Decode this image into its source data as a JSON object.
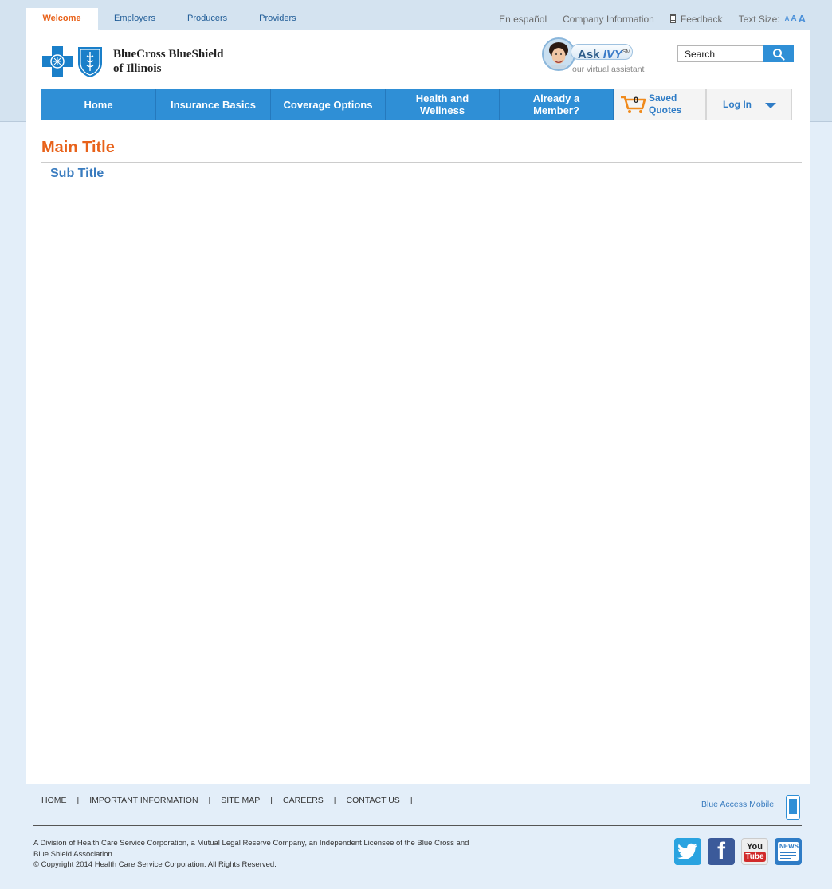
{
  "audience_tabs": [
    "Welcome",
    "Employers",
    "Producers",
    "Providers"
  ],
  "utility": {
    "espanol": "En español",
    "company_info": "Company Information",
    "feedback": "Feedback",
    "text_size_label": "Text Size:",
    "text_size_options": [
      "A",
      "A",
      "A"
    ]
  },
  "brand": {
    "line1": "BlueCross BlueShield",
    "line2": "of Illinois"
  },
  "ivy": {
    "ask": "Ask ",
    "name": "IVY",
    "sm": "SM",
    "subtitle": "our virtual assistant"
  },
  "search": {
    "value": "Search"
  },
  "nav": {
    "items": [
      "Home",
      "Insurance Basics",
      "Coverage Options",
      "Health and Wellness",
      "Already a Member?"
    ],
    "saved_count": "0",
    "saved_label_1": "Saved",
    "saved_label_2": "Quotes",
    "login": "Log In"
  },
  "content": {
    "main_title": "Main Title",
    "sub_title": "Sub Title"
  },
  "footer": {
    "links": [
      "HOME",
      "IMPORTANT INFORMATION",
      "SITE MAP",
      "CAREERS",
      "CONTACT US"
    ],
    "separator": "|",
    "mobile": "Blue Access Mobile",
    "legal_1": "A Division of Health Care Service Corporation, a Mutual Legal Reserve Company, an Independent Licensee of the Blue Cross and",
    "legal_2": "Blue Shield Association.",
    "legal_3": "© Copyright 2014 Health Care Service Corporation. All Rights Reserved.",
    "social": {
      "facebook_glyph": "f",
      "youtube_you": "You",
      "youtube_tube": "Tube",
      "news": "NEWS"
    }
  },
  "colors": {
    "brand_blue": "#2f8fd6",
    "accent_orange": "#e8621a",
    "page_bg": "#e3eef9"
  }
}
